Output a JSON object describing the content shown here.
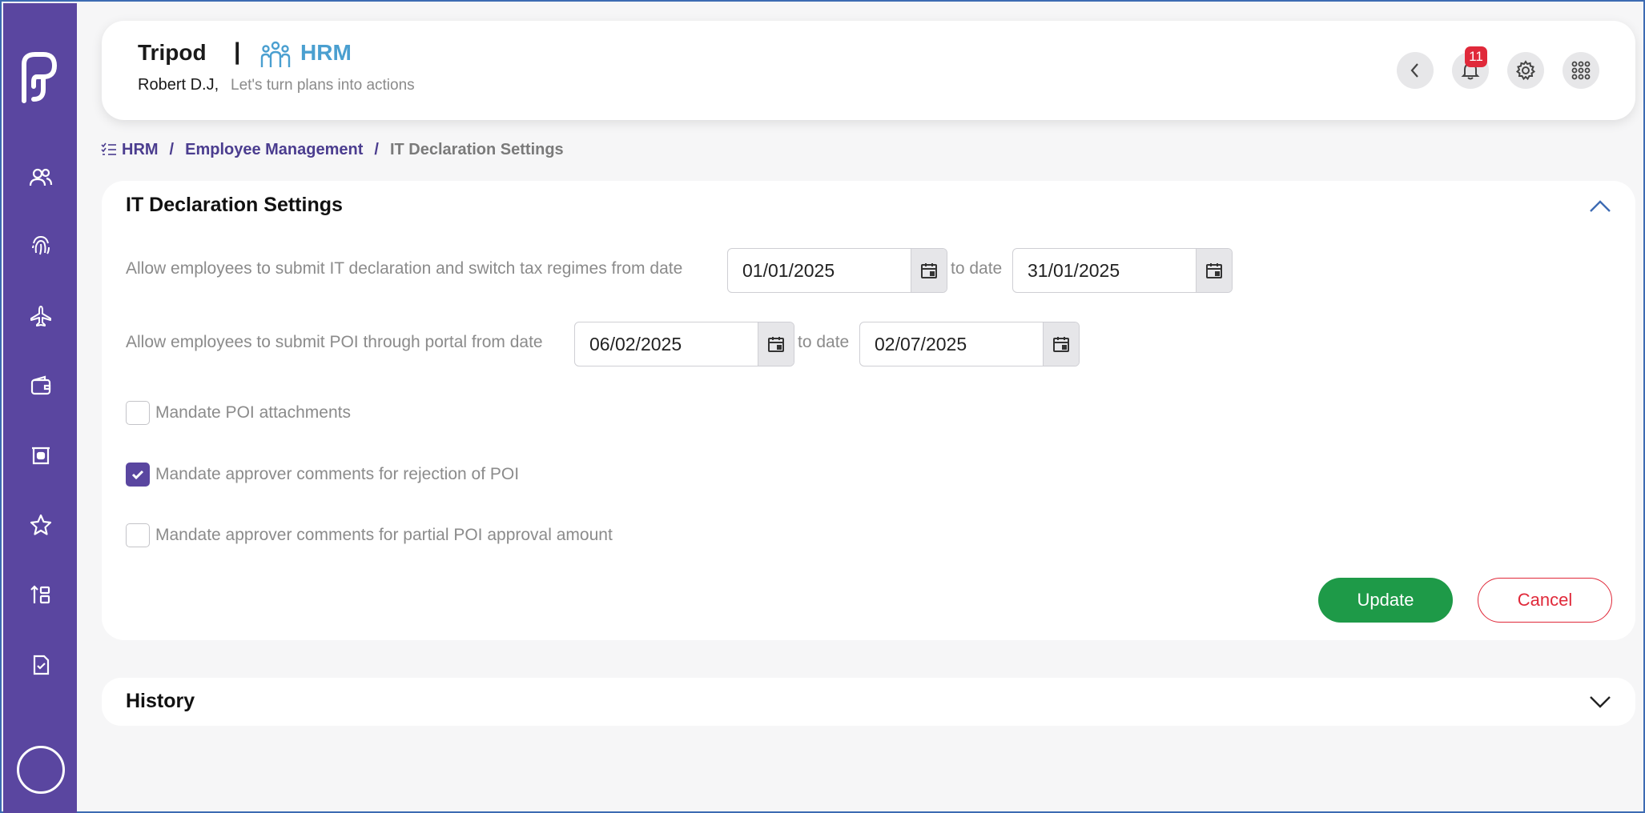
{
  "header": {
    "app_name": "Tripod",
    "separator": "|",
    "module_name": "HRM",
    "user_name": "Robert D.J,",
    "tagline": "Let's turn plans into actions",
    "notification_count": "11"
  },
  "sidebar": {
    "items": [
      {
        "icon": "people-icon"
      },
      {
        "icon": "fingerprint-icon"
      },
      {
        "icon": "airplane-icon"
      },
      {
        "icon": "wallet-icon"
      },
      {
        "icon": "id-card-icon"
      },
      {
        "icon": "star-icon"
      },
      {
        "icon": "hierarchy-icon"
      },
      {
        "icon": "document-check-icon"
      }
    ]
  },
  "breadcrumb": {
    "items": [
      "HRM",
      "Employee Management"
    ],
    "separator": "/",
    "current": "IT Declaration Settings"
  },
  "settings": {
    "title": "IT Declaration Settings",
    "it_declaration": {
      "label": "Allow employees to submit IT declaration and switch tax regimes from date",
      "from": "01/01/2025",
      "to_label": "to date",
      "to": "31/01/2025"
    },
    "poi_submission": {
      "label": "Allow employees to submit POI through portal from date",
      "from": "06/02/2025",
      "to_label": "to date",
      "to": "02/07/2025"
    },
    "checkboxes": [
      {
        "label": "Mandate POI attachments",
        "checked": false
      },
      {
        "label": "Mandate approver comments for rejection of POI",
        "checked": true
      },
      {
        "label": "Mandate approver comments for partial POI approval amount",
        "checked": false
      }
    ],
    "update_label": "Update",
    "cancel_label": "Cancel"
  },
  "history": {
    "title": "History"
  },
  "colors": {
    "sidebar": "#5a46a0",
    "accent": "#4a9fd0",
    "update": "#1e9a48",
    "cancel": "#e0293a",
    "badge": "#e0293a"
  }
}
